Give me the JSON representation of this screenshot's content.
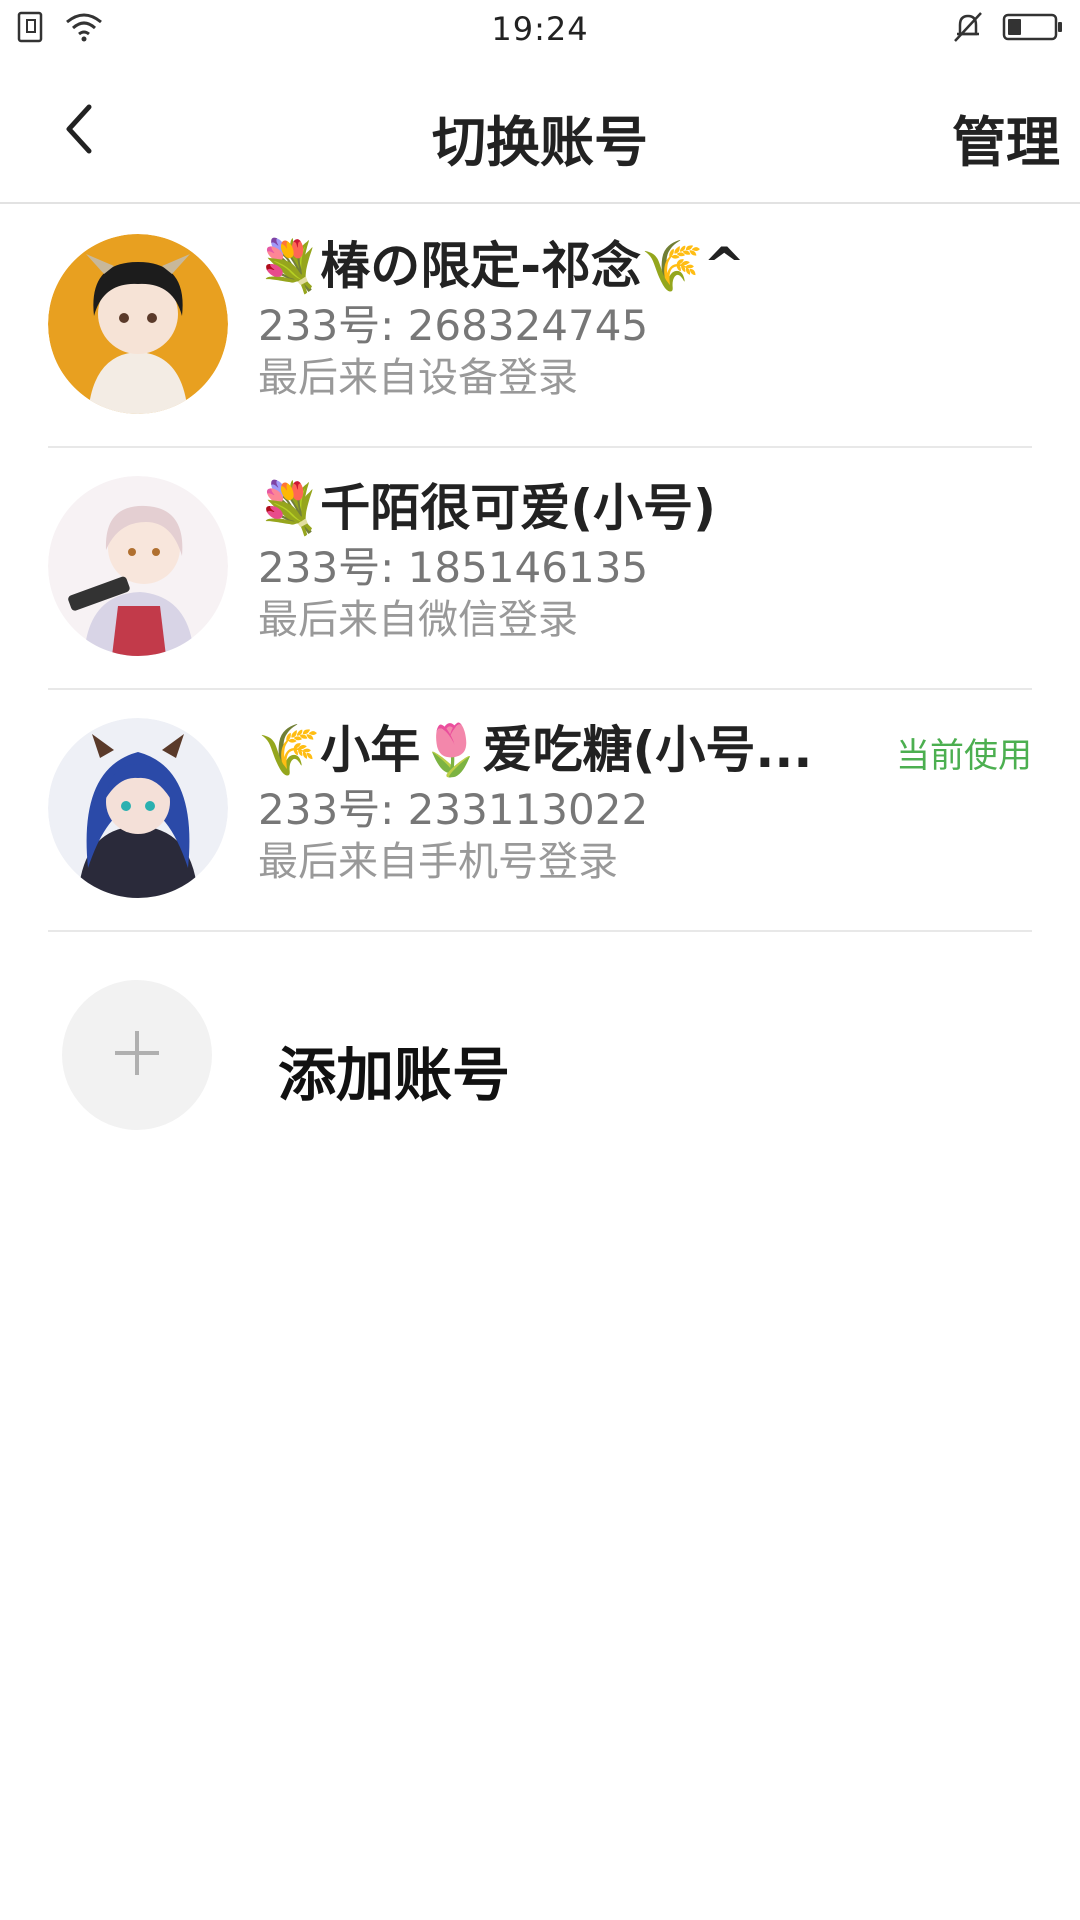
{
  "status_bar": {
    "time": "19:24",
    "left_icons": [
      "sim-card-icon",
      "wifi-icon"
    ],
    "right_icons": [
      "notifications-muted-icon",
      "battery-icon"
    ]
  },
  "header": {
    "back_icon": "chevron-left-icon",
    "title": "切换账号",
    "manage_label": "管理"
  },
  "accounts": [
    {
      "name": "💐椿の限定-祁念🌾^",
      "uid": "233号: 268324745",
      "login": "最后来自设备登录",
      "current": ""
    },
    {
      "name": "💐千陌很可爱(小号)",
      "uid": "233号: 185146135",
      "login": "最后来自微信登录",
      "current": ""
    },
    {
      "name": "🌾小年🌷爱吃糖(小号...",
      "uid": "233号: 233113022",
      "login": "最后来自手机号登录",
      "current": "当前使用"
    }
  ],
  "add_account": {
    "icon": "plus-icon",
    "label": "添加账号"
  },
  "colors": {
    "current_badge": "#4caf50",
    "divider": "#e8e8e8"
  }
}
